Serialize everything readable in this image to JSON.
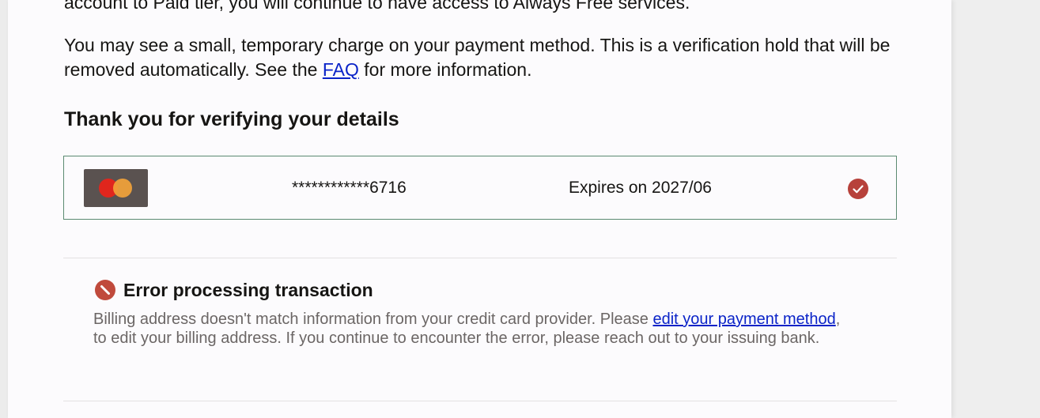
{
  "intro": {
    "partial_line": "account to Paid tier, you will continue to have access to Always Free services.",
    "hold_text_1": "You may see a small, temporary charge on your payment method. This is a verification hold that will be removed automatically. See the ",
    "faq_link": "FAQ",
    "hold_text_2": " for more information."
  },
  "verification": {
    "heading": "Thank you for verifying your details",
    "card": {
      "brand_icon": "mastercard-logo",
      "number": "************6716",
      "expiry": "Expires on 2027/06",
      "status_icon": "check-circle-icon"
    }
  },
  "error": {
    "icon": "error-circle-icon",
    "title": "Error processing transaction",
    "body_1": "Billing address doesn't match information from your credit card provider. Please ",
    "link": "edit your payment method",
    "body_2": ", to edit your billing address. If you continue to encounter the error, please reach out to your issuing bank."
  },
  "colors": {
    "card_border": "#5b8a71",
    "check_badge": "#b7413b",
    "error_icon": "#c04a3c",
    "link": "#0a23c8"
  }
}
